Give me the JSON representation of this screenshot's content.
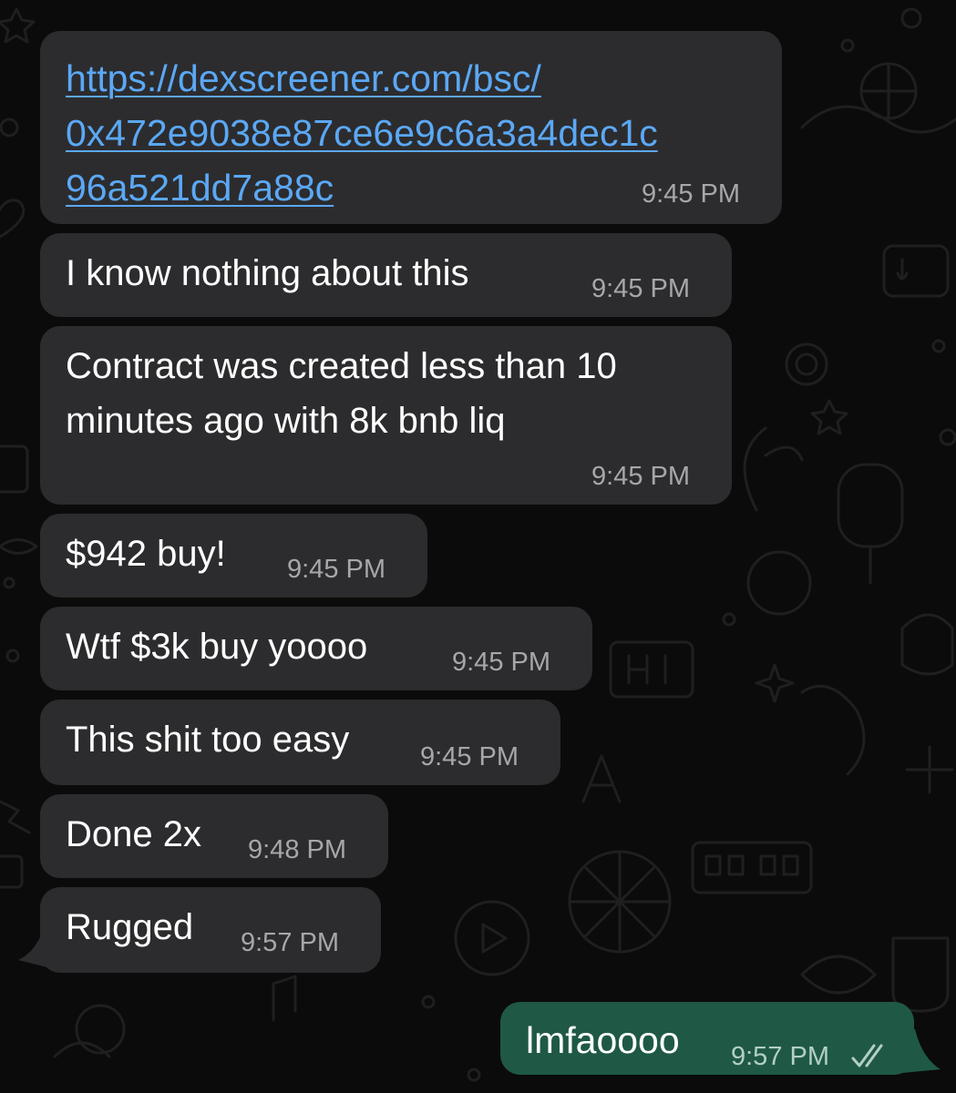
{
  "chat": {
    "incoming": [
      {
        "line1": "https://dexscreener.com/bsc/",
        "line2": "0x472e9038e87ce6e9c6a3a4dec1c",
        "line3": "96a521dd7a88c",
        "time": "9:45 PM"
      },
      {
        "text": "I know nothing about this",
        "time": "9:45 PM"
      },
      {
        "line1": "Contract was created less than 10",
        "line2": "minutes ago with 8k bnb liq",
        "time": "9:45 PM"
      },
      {
        "text": "$942 buy!",
        "time": "9:45 PM"
      },
      {
        "text": "Wtf $3k buy yoooo",
        "time": "9:45 PM"
      },
      {
        "text": "This shit too easy",
        "time": "9:45 PM"
      },
      {
        "text": "Done 2x",
        "time": "9:48 PM"
      },
      {
        "text": "Rugged",
        "time": "9:57 PM"
      }
    ],
    "outgoing": [
      {
        "text": "lmfaoooo",
        "time": "9:57 PM",
        "status": "read-double-check-icon"
      }
    ]
  },
  "colors": {
    "incoming_bubble": "#2c2c2e",
    "outgoing_bubble": "#1f5945",
    "link": "#5ba8f5",
    "background": "#0b0b0b"
  }
}
